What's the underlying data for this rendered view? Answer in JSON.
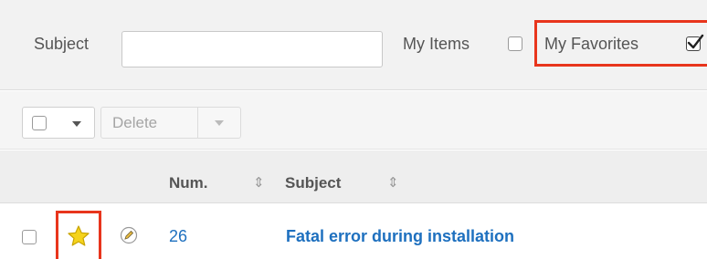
{
  "filter": {
    "subject_label": "Subject",
    "subject_value": "",
    "my_items_label": "My Items",
    "my_items_checked": false,
    "my_favorites_label": "My Favorites",
    "my_favorites_checked": true
  },
  "toolbar": {
    "delete_label": "Delete"
  },
  "table": {
    "columns": [
      "Num.",
      "Subject"
    ],
    "rows": [
      {
        "num": "26",
        "subject": "Fatal error during installation",
        "favorite": true
      }
    ]
  },
  "colors": {
    "highlight": "#e8351c",
    "link": "#1e70bf",
    "favorite_star": "#f5d31c"
  },
  "icons": [
    "sort-icon",
    "star-icon",
    "pencil-icon",
    "chevron-down-icon",
    "checkmark-icon"
  ]
}
